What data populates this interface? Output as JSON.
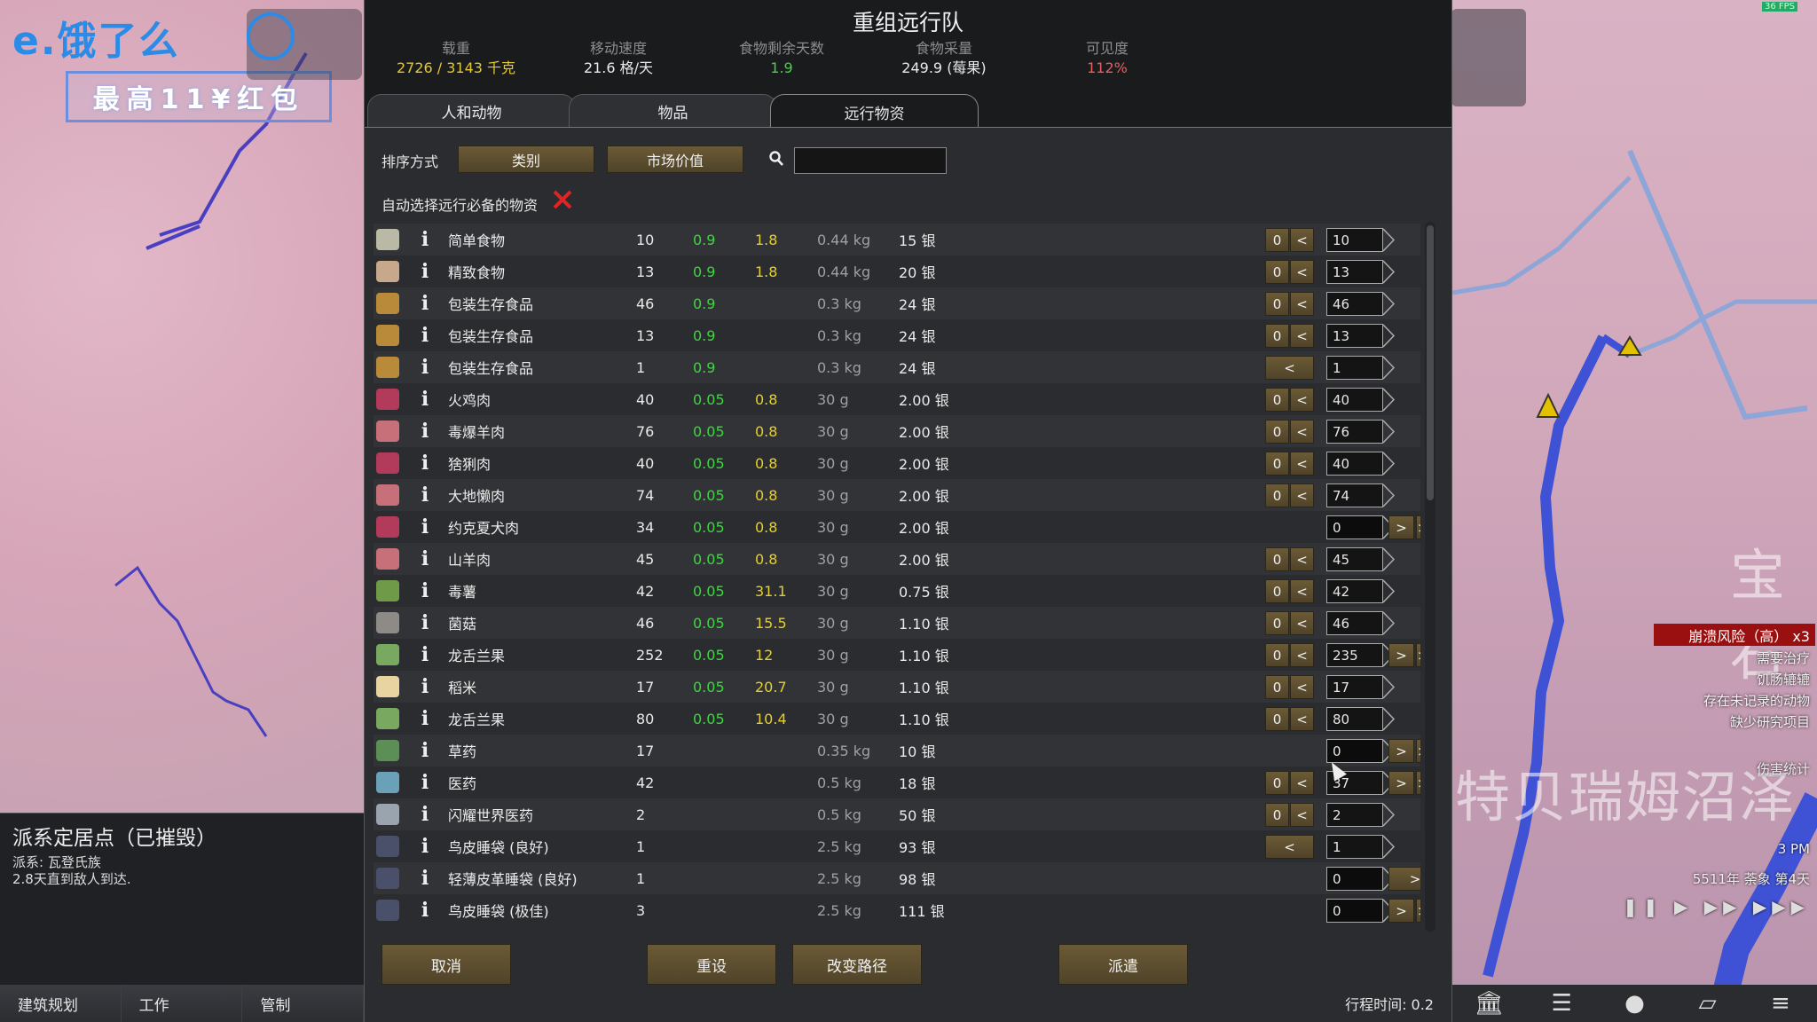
{
  "background": {
    "brand": "e.饿了么",
    "promo": "最高11¥红包",
    "fps": "36 FPS",
    "map_label_1": "特贝瑞姆沼泽",
    "map_label_2": "宝石"
  },
  "inspect": {
    "title": "派系定居点（已摧毁）",
    "lines": [
      "派系: 瓦登氏族",
      "2.8天直到敌人到达."
    ]
  },
  "bottom_tabs": [
    "建筑规划",
    "工作",
    "管制"
  ],
  "hud": {
    "alert": "崩溃风险（高） x3",
    "alerts": [
      "需要治疗",
      "饥肠辘辘",
      "存在未记录的动物",
      "缺少研究项目"
    ],
    "damage": "伤害统计",
    "time": "3 PM",
    "date": "5511年 荼象 第4天",
    "speed": "❚❚ ▶ ▶▶ ▶▶▶"
  },
  "dialog": {
    "title": "重组远行队",
    "stats": [
      {
        "label": "载重",
        "value": "2726 / 3143 千克",
        "color": "yellow"
      },
      {
        "label": "移动速度",
        "value": "21.6 格/天",
        "color": "white"
      },
      {
        "label": "食物剩余天数",
        "value": "1.9",
        "color": "green"
      },
      {
        "label": "食物采量",
        "value": "249.9 (莓果)",
        "color": "white"
      },
      {
        "label": "可见度",
        "value": "112%",
        "color": "red"
      }
    ],
    "tabs": [
      "人和动物",
      "物品",
      "远行物资"
    ],
    "active_tab": 2,
    "sort_label": "排序方式",
    "sort_buttons": [
      "类别",
      "市场价值"
    ],
    "search_placeholder": "",
    "auto_select_label": "自动选择远行必备的物资",
    "columns_hidden": true,
    "rows": [
      {
        "icon": "simple-meal-icon",
        "name": "简单食物",
        "count": "10",
        "nut": "0.9",
        "days": "1.8",
        "mass": "0.44 kg",
        "price": "15 银",
        "controls": "minus",
        "qty": "10",
        "qtyHi": true
      },
      {
        "icon": "fine-meal-icon",
        "name": "精致食物",
        "count": "13",
        "nut": "0.9",
        "days": "1.8",
        "mass": "0.44 kg",
        "price": "20 银",
        "controls": "minus",
        "qty": "13",
        "qtyHi": true
      },
      {
        "icon": "packaged-meal-icon",
        "name": "包装生存食品",
        "count": "46",
        "nut": "0.9",
        "days": "",
        "mass": "0.3 kg",
        "price": "24 银",
        "controls": "minus",
        "qty": "46",
        "qtyHi": true
      },
      {
        "icon": "packaged-meal-icon",
        "name": "包装生存食品",
        "count": "13",
        "nut": "0.9",
        "days": "",
        "mass": "0.3 kg",
        "price": "24 银",
        "controls": "minus",
        "qty": "13",
        "qtyHi": true
      },
      {
        "icon": "packaged-meal-icon",
        "name": "包装生存食品",
        "count": "1",
        "nut": "0.9",
        "days": "",
        "mass": "0.3 kg",
        "price": "24 银",
        "controls": "minus-wide",
        "qty": "1",
        "qtyHi": true
      },
      {
        "icon": "meat-icon",
        "name": "火鸡肉",
        "count": "40",
        "nut": "0.05",
        "days": "0.8",
        "mass": "30 g",
        "price": "2.00 银",
        "controls": "minus",
        "qty": "40",
        "qtyHi": true
      },
      {
        "icon": "raw-meat-icon",
        "name": "毒爆羊肉",
        "count": "76",
        "nut": "0.05",
        "days": "0.8",
        "mass": "30 g",
        "price": "2.00 银",
        "controls": "minus",
        "qty": "76",
        "qtyHi": true
      },
      {
        "icon": "meat-icon",
        "name": "猞猁肉",
        "count": "40",
        "nut": "0.05",
        "days": "0.8",
        "mass": "30 g",
        "price": "2.00 银",
        "controls": "minus",
        "qty": "40",
        "qtyHi": true
      },
      {
        "icon": "raw-meat-icon",
        "name": "大地懒肉",
        "count": "74",
        "nut": "0.05",
        "days": "0.8",
        "mass": "30 g",
        "price": "2.00 银",
        "controls": "minus",
        "qty": "74",
        "qtyHi": true
      },
      {
        "icon": "meat-icon",
        "name": "约克夏犬肉",
        "count": "34",
        "nut": "0.05",
        "days": "0.8",
        "mass": "30 g",
        "price": "2.00 银",
        "controls": "plus",
        "qty": "0",
        "qtyHi": false
      },
      {
        "icon": "raw-meat-icon",
        "name": "山羊肉",
        "count": "45",
        "nut": "0.05",
        "days": "0.8",
        "mass": "30 g",
        "price": "2.00 银",
        "controls": "minus",
        "qty": "45",
        "qtyHi": true
      },
      {
        "icon": "potato-icon",
        "name": "毒薯",
        "count": "42",
        "nut": "0.05",
        "days": "31.1",
        "mass": "30 g",
        "price": "0.75 银",
        "controls": "minus",
        "qty": "42",
        "qtyHi": true
      },
      {
        "icon": "mushroom-icon",
        "name": "菌菇",
        "count": "46",
        "nut": "0.05",
        "days": "15.5",
        "mass": "30 g",
        "price": "1.10 银",
        "controls": "minus",
        "qty": "46",
        "qtyHi": true
      },
      {
        "icon": "agave-icon",
        "name": "龙舌兰果",
        "count": "252",
        "nut": "0.05",
        "days": "12",
        "mass": "30 g",
        "price": "1.10 银",
        "controls": "both",
        "qty": "235",
        "qtyHi": true
      },
      {
        "icon": "rice-icon",
        "name": "稻米",
        "count": "17",
        "nut": "0.05",
        "days": "20.7",
        "mass": "30 g",
        "price": "1.10 银",
        "controls": "minus",
        "qty": "17",
        "qtyHi": true
      },
      {
        "icon": "agave-icon",
        "name": "龙舌兰果",
        "count": "80",
        "nut": "0.05",
        "days": "10.4",
        "mass": "30 g",
        "price": "1.10 银",
        "controls": "minus",
        "qty": "80",
        "qtyHi": true
      },
      {
        "icon": "herbal-medicine-icon",
        "name": "草药",
        "count": "17",
        "nut": "",
        "days": "",
        "mass": "0.35 kg",
        "price": "10 银",
        "controls": "plus",
        "qty": "0",
        "qtyHi": false
      },
      {
        "icon": "medicine-icon",
        "name": "医药",
        "count": "42",
        "nut": "",
        "days": "",
        "mass": "0.5 kg",
        "price": "18 银",
        "controls": "both",
        "qty": "37",
        "qtyHi": true
      },
      {
        "icon": "glitterworld-medicine-icon",
        "name": "闪耀世界医药",
        "count": "2",
        "nut": "",
        "days": "",
        "mass": "0.5 kg",
        "price": "50 银",
        "controls": "minus",
        "qty": "2",
        "qtyHi": true
      },
      {
        "icon": "bedroll-icon",
        "name": "鸟皮睡袋 (良好)",
        "count": "1",
        "nut": "",
        "days": "",
        "mass": "2.5 kg",
        "price": "93 银",
        "controls": "minus-wide",
        "qty": "1",
        "qtyHi": true
      },
      {
        "icon": "bedroll-icon",
        "name": "轻薄皮革睡袋 (良好)",
        "count": "1",
        "nut": "",
        "days": "",
        "mass": "2.5 kg",
        "price": "98 银",
        "controls": "plus-wide",
        "qty": "0",
        "qtyHi": false
      },
      {
        "icon": "bedroll-icon",
        "name": "鸟皮睡袋 (极佳)",
        "count": "3",
        "nut": "",
        "days": "",
        "mass": "2.5 kg",
        "price": "111 银",
        "controls": "plus",
        "qty": "0",
        "qtyHi": false
      }
    ],
    "footer": {
      "cancel": "取消",
      "reset": "重设",
      "reroute": "改变路径",
      "send": "派遣",
      "trip_time": "行程时间:  0.2"
    },
    "btn_zero": "0",
    "btn_lt": "<",
    "btn_gt": ">",
    "btn_gtgt": ">>",
    "info_glyph": "i"
  },
  "colors": {
    "yellow": "#e6c830",
    "green": "#45d14a",
    "red": "#ee5c5c",
    "button": "#5e4f30",
    "alert": "#9a0f0f"
  }
}
